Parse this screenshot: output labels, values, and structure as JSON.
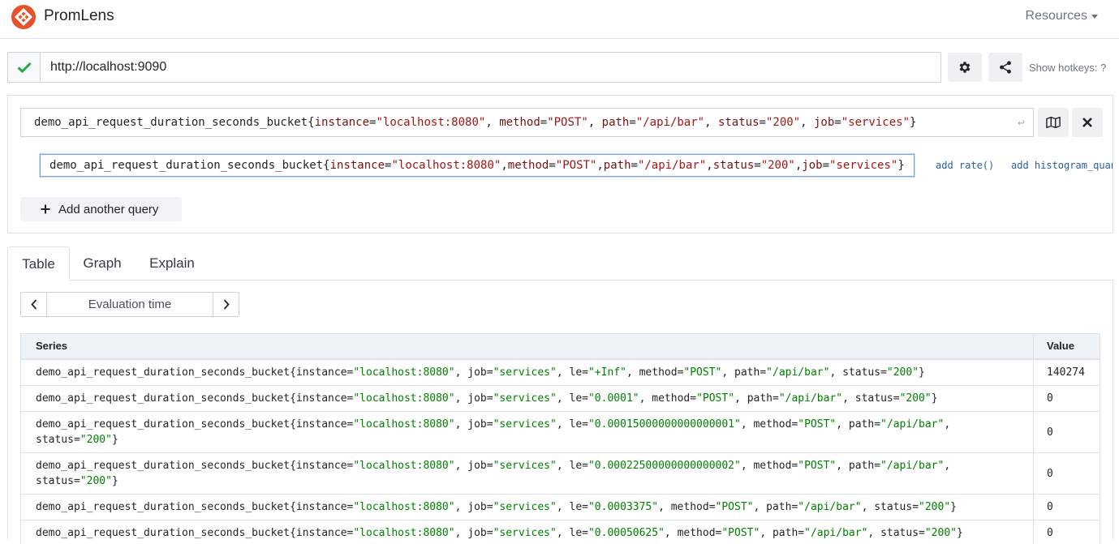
{
  "colors": {
    "brand": "#e6522c",
    "success": "#28a745",
    "label_string": "#a31515",
    "result_string": "#008000",
    "link": "#2a5d9f"
  },
  "navbar": {
    "brand": "PromLens",
    "resources": "Resources"
  },
  "server": {
    "url": "http://localhost:9090",
    "status_icon": "check-icon",
    "hotkeys": "Show hotkeys: ?"
  },
  "query": {
    "expression": [
      {
        "t": "demo_api_request_duration_seconds_bucket",
        "c": "m"
      },
      {
        "t": "{",
        "c": "p"
      },
      {
        "t": "instance",
        "c": "l"
      },
      {
        "t": "=",
        "c": "p"
      },
      {
        "t": "\"localhost:8080\"",
        "c": "s"
      },
      {
        "t": ", ",
        "c": "p"
      },
      {
        "t": "method",
        "c": "l"
      },
      {
        "t": "=",
        "c": "p"
      },
      {
        "t": "\"POST\"",
        "c": "s"
      },
      {
        "t": ", ",
        "c": "p"
      },
      {
        "t": "path",
        "c": "l"
      },
      {
        "t": "=",
        "c": "p"
      },
      {
        "t": "\"/api/bar\"",
        "c": "s"
      },
      {
        "t": ", ",
        "c": "p"
      },
      {
        "t": "status",
        "c": "l"
      },
      {
        "t": "=",
        "c": "p"
      },
      {
        "t": "\"200\"",
        "c": "s"
      },
      {
        "t": ", ",
        "c": "p"
      },
      {
        "t": "job",
        "c": "l"
      },
      {
        "t": "=",
        "c": "p"
      },
      {
        "t": "\"services\"",
        "c": "s"
      },
      {
        "t": "}",
        "c": "p"
      }
    ],
    "tree_node": [
      {
        "t": "demo_api_request_duration_seconds_bucket",
        "c": "m"
      },
      {
        "t": "{",
        "c": "p"
      },
      {
        "t": "instance",
        "c": "l"
      },
      {
        "t": "=",
        "c": "p"
      },
      {
        "t": "\"localhost:8080\"",
        "c": "s"
      },
      {
        "t": ",",
        "c": "p"
      },
      {
        "t": "method",
        "c": "l"
      },
      {
        "t": "=",
        "c": "p"
      },
      {
        "t": "\"POST\"",
        "c": "s"
      },
      {
        "t": ",",
        "c": "p"
      },
      {
        "t": "path",
        "c": "l"
      },
      {
        "t": "=",
        "c": "p"
      },
      {
        "t": "\"/api/bar\"",
        "c": "s"
      },
      {
        "t": ",",
        "c": "p"
      },
      {
        "t": "status",
        "c": "l"
      },
      {
        "t": "=",
        "c": "p"
      },
      {
        "t": "\"200\"",
        "c": "s"
      },
      {
        "t": ",",
        "c": "p"
      },
      {
        "t": "job",
        "c": "l"
      },
      {
        "t": "=",
        "c": "p"
      },
      {
        "t": "\"services\"",
        "c": "s"
      },
      {
        "t": "}",
        "c": "p"
      }
    ],
    "actions": [
      "add rate()",
      "add histogram_quant"
    ],
    "add_query": "Add another query"
  },
  "tabs": [
    {
      "label": "Table",
      "active": true
    },
    {
      "label": "Graph",
      "active": false
    },
    {
      "label": "Explain",
      "active": false
    }
  ],
  "eval": {
    "placeholder": "Evaluation time"
  },
  "table": {
    "headers": {
      "series": "Series",
      "value": "Value"
    },
    "rows": [
      {
        "le": "+Inf",
        "value": "140274",
        "wrap": false
      },
      {
        "le": "0.0001",
        "value": "0",
        "wrap": false
      },
      {
        "le": "0.00015000000000000001",
        "value": "0",
        "wrap": true
      },
      {
        "le": "0.00022500000000000002",
        "value": "0",
        "wrap": true
      },
      {
        "le": "0.0003375",
        "value": "0",
        "wrap": false
      },
      {
        "le": "0.00050625",
        "value": "0",
        "wrap": false
      }
    ],
    "series_metric": "demo_api_request_duration_seconds_bucket",
    "series_labels": [
      {
        "k": "instance",
        "v": "localhost:8080"
      },
      {
        "k": "job",
        "v": "services"
      },
      {
        "k": "le",
        "v": null
      },
      {
        "k": "method",
        "v": "POST"
      },
      {
        "k": "path",
        "v": "/api/bar"
      },
      {
        "k": "status",
        "v": "200"
      }
    ]
  }
}
